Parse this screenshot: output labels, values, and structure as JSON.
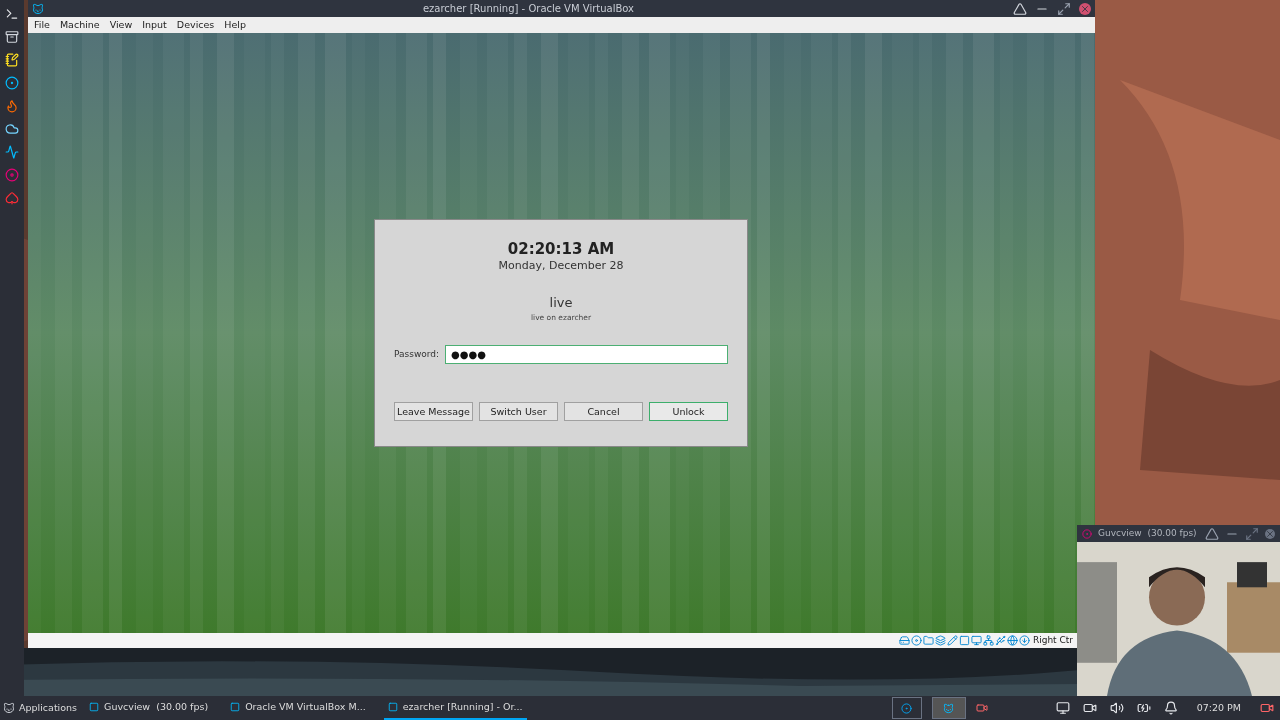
{
  "window": {
    "title": "ezarcher [Running] - Oracle VM VirtualBox"
  },
  "menu": [
    "File",
    "Machine",
    "View",
    "Input",
    "Devices",
    "Help"
  ],
  "lock_dialog": {
    "time": "02:20:13 AM",
    "date": "Monday, December 28",
    "user": "live",
    "user_host": "live on ezarcher",
    "password_label": "Password:",
    "password_value": "●●●●",
    "buttons": [
      {
        "label": "Leave Message",
        "selected": false
      },
      {
        "label": "Switch User",
        "selected": false
      },
      {
        "label": "Cancel",
        "selected": false
      },
      {
        "label": "Unlock",
        "selected": true
      }
    ]
  },
  "status_bar": {
    "host_key": "Right Ctr"
  },
  "webcam_window": {
    "title": "Guvcview  (30.00 fps)"
  },
  "taskbar": {
    "menu": "Applications",
    "tasks": [
      {
        "label": "Guvcview  (30.00 fps)",
        "selected": false
      },
      {
        "label": "Oracle VM VirtualBox M...",
        "selected": false
      },
      {
        "label": "ezarcher [Running] - Or...",
        "selected": true
      }
    ],
    "clock": "07:20 PM"
  }
}
